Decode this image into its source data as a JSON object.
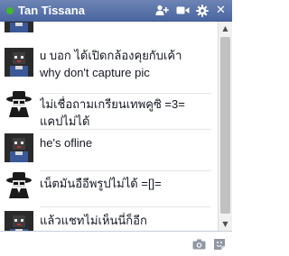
{
  "chat": {
    "contact_name": "Tan Tissana",
    "status": "online",
    "status_color": "#42b72a",
    "header_color": "#4a66a0",
    "toolbar_icons": [
      "add-friend-icon",
      "video-call-icon",
      "gear-icon",
      "close-icon"
    ],
    "close_glyph": "✕"
  },
  "messages": [
    {
      "avatar": "pixel-character-avatar",
      "lines": []
    },
    {
      "avatar": "pixel-character-avatar",
      "lines": [
        "u บอก ได้เปิดกล้องคุยกับเค้า",
        "why don't capture pic"
      ]
    },
    {
      "avatar": "hat-character-avatar",
      "lines": [
        "ไม่เชื่อถามเกรียนเทพคูซิ =3=",
        "แคปไม่ได้"
      ]
    },
    {
      "avatar": "pixel-character-avatar",
      "lines": [
        "he's ofline"
      ]
    },
    {
      "avatar": "hat-character-avatar",
      "lines": [
        "เน็ตมันอือีพรูปไม่ได้ =[]="
      ]
    },
    {
      "avatar": "pixel-character-avatar",
      "lines": [
        "แล้วแชทไม่เห็นนี่ก็อีก",
        ""
      ]
    }
  ],
  "composer": {
    "placeholder": "",
    "icons": [
      "camera-icon",
      "sticker-icon"
    ]
  }
}
